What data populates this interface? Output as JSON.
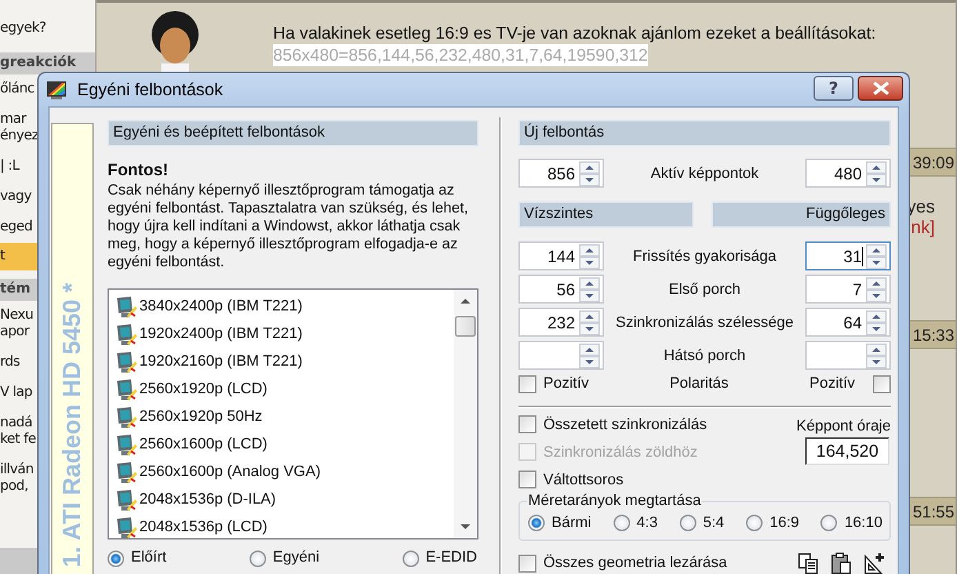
{
  "forum": {
    "sidebar": [
      {
        "kind": "text",
        "lines": [
          "egyek?"
        ]
      },
      {
        "kind": "header",
        "lines": [
          "greakciók"
        ]
      },
      {
        "kind": "text",
        "lines": [
          "őlánc"
        ]
      },
      {
        "kind": "text",
        "lines": [
          "mar",
          "ényez"
        ]
      },
      {
        "kind": "text",
        "lines": [
          "| :L"
        ]
      },
      {
        "kind": "text",
        "lines": [
          "vagy"
        ]
      },
      {
        "kind": "text",
        "lines": [
          "eged"
        ]
      },
      {
        "kind": "highlight",
        "lines": [
          "t"
        ]
      },
      {
        "kind": "header",
        "lines": [
          "tém"
        ]
      },
      {
        "kind": "text",
        "lines": [
          "Nexu",
          "apor"
        ]
      },
      {
        "kind": "text",
        "lines": [
          "rds"
        ]
      },
      {
        "kind": "text",
        "lines": [
          "V lap"
        ]
      },
      {
        "kind": "text",
        "lines": [
          "nadá",
          "ket fe"
        ]
      },
      {
        "kind": "text",
        "lines": [
          "illván",
          "pod,"
        ]
      },
      {
        "kind": "bar"
      }
    ],
    "post": {
      "lines": [
        {
          "text": "Ha valakinek esetleg 16:9 es TV-je van azoknak ajánlom ezeket a beállításokat:",
          "selected": false
        },
        {
          "text": "856x480=856,144,56,232,480,31,7,64,19590,312",
          "selected": true
        }
      ]
    },
    "thread": [
      {
        "kind": "time",
        "text": "39:09"
      },
      {
        "kind": "text",
        "text": "yes"
      },
      {
        "kind": "link",
        "text": "nk]"
      },
      {
        "kind": "time",
        "text": "15:33"
      },
      {
        "kind": "time",
        "text": "51:55"
      }
    ]
  },
  "dialog": {
    "title": "Egyéni felbontások",
    "help_button": "?",
    "adapter_label": "1. ATI Radeon HD 5450 *",
    "left_panel": {
      "header": "Egyéni és beépített felbontások",
      "notice_title": "Fontos!",
      "notice_text": "Csak néhány képernyő illesztőprogram támogatja az egyéni felbontást. Tapasztalatra van szükség, és lehet, hogy újra kell indítani a Windowst, akkor láthatja csak meg, hogy a képernyő illesztőprogram elfogadja-e az egyéni felbontást.",
      "resolutions": [
        {
          "label": "3840x2400p (IBM T221)",
          "selected": false
        },
        {
          "label": "1920x2400p (IBM T221)",
          "selected": false
        },
        {
          "label": "1920x2160p (IBM T221)",
          "selected": false
        },
        {
          "label": "2560x1920p (LCD)",
          "selected": false
        },
        {
          "label": "2560x1920p 50Hz",
          "selected": false
        },
        {
          "label": "2560x1600p (LCD)",
          "selected": false
        },
        {
          "label": "2560x1600p (Analog VGA)",
          "selected": false
        },
        {
          "label": "2048x1536p (D-ILA)",
          "selected": false
        },
        {
          "label": "2048x1536p (LCD)",
          "selected": false
        }
      ],
      "source_options": [
        {
          "label": "Előírt",
          "selected": true
        },
        {
          "label": "Egyéni",
          "selected": false
        },
        {
          "label": "E-EDID",
          "selected": false
        }
      ]
    },
    "right_panel": {
      "header": "Új felbontás",
      "active_pixels": {
        "horizontal": "856",
        "label": "Aktív képpontok",
        "vertical": "480"
      },
      "horizontal_header": "Vízszintes",
      "vertical_header": "Függőleges",
      "timings": [
        {
          "horizontal": "144",
          "label": "Frissítés gyakorisága",
          "vertical": "31",
          "vertical_focused": true
        },
        {
          "horizontal": "56",
          "label": "Első porch",
          "vertical": "7",
          "vertical_focused": false
        },
        {
          "horizontal": "232",
          "label": "Szinkronizálás szélessége",
          "vertical": "64",
          "vertical_focused": false
        },
        {
          "label": "Hátsó porch",
          "vertical_focused": false
        }
      ],
      "polarity": {
        "label": "Polaritás",
        "horizontal": {
          "label": "Pozitív",
          "checked": false
        },
        "vertical": {
          "label": "Pozitív",
          "checked": false
        }
      },
      "options": [
        {
          "label": "Összetett szinkronizálás",
          "checked": false,
          "disabled": false
        },
        {
          "label": "Szinkronizálás zöldhöz",
          "checked": false,
          "disabled": true
        },
        {
          "label": "Váltottsoros",
          "checked": false,
          "disabled": false
        }
      ],
      "pixel_clock": {
        "label": "Képpont óraje",
        "value": "164,520"
      },
      "aspect_ratio": {
        "title": "Méretarányok megtartása",
        "options": [
          {
            "label": "Bármi",
            "selected": true
          },
          {
            "label": "4:3",
            "selected": false
          },
          {
            "label": "5:4",
            "selected": false
          },
          {
            "label": "16:9",
            "selected": false
          },
          {
            "label": "16:10",
            "selected": false
          }
        ]
      },
      "lock_geometry": {
        "label": "Összes geometria lezárása",
        "checked": false
      }
    }
  }
}
